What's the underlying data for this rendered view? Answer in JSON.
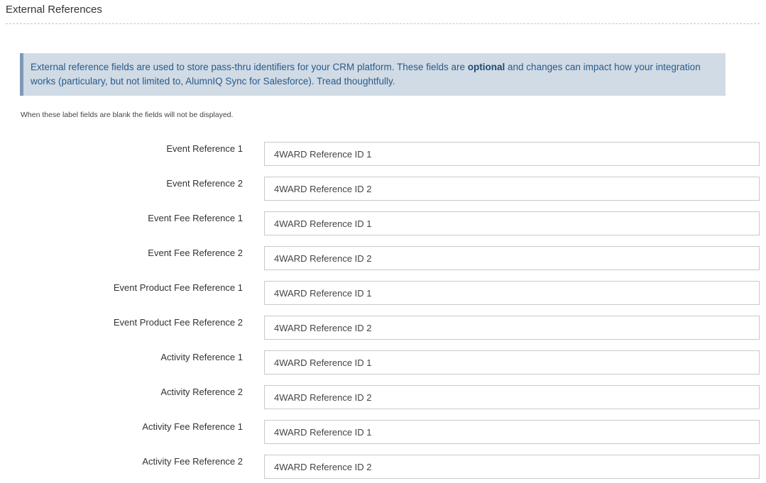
{
  "section": {
    "title": "External References"
  },
  "notice": {
    "text_before": "External reference fields are used to store pass-thru identifiers for your CRM platform. These fields are ",
    "text_bold": "optional",
    "text_after": " and changes can impact how your integration works (particulary, but not limited to, AlumnIQ Sync for Salesforce). Tread thoughtfully."
  },
  "hint": "When these label fields are blank the fields will not be displayed.",
  "fields": [
    {
      "label": "Event Reference 1",
      "value": "4WARD Reference ID 1"
    },
    {
      "label": "Event Reference 2",
      "value": "4WARD Reference ID 2"
    },
    {
      "label": "Event Fee Reference 1",
      "value": "4WARD Reference ID 1"
    },
    {
      "label": "Event Fee Reference 2",
      "value": "4WARD Reference ID 2"
    },
    {
      "label": "Event Product Fee Reference 1",
      "value": "4WARD Reference ID 1"
    },
    {
      "label": "Event Product Fee Reference 2",
      "value": "4WARD Reference ID 2"
    },
    {
      "label": "Activity Reference 1",
      "value": "4WARD Reference ID 1"
    },
    {
      "label": "Activity Reference 2",
      "value": "4WARD Reference ID 2"
    },
    {
      "label": "Activity Fee Reference 1",
      "value": "4WARD Reference ID 1"
    },
    {
      "label": "Activity Fee Reference 2",
      "value": "4WARD Reference ID 2"
    }
  ],
  "colors": {
    "notice_background": "#d0dbe5",
    "notice_border": "#7e99b6",
    "notice_text": "#2a5a8b"
  }
}
